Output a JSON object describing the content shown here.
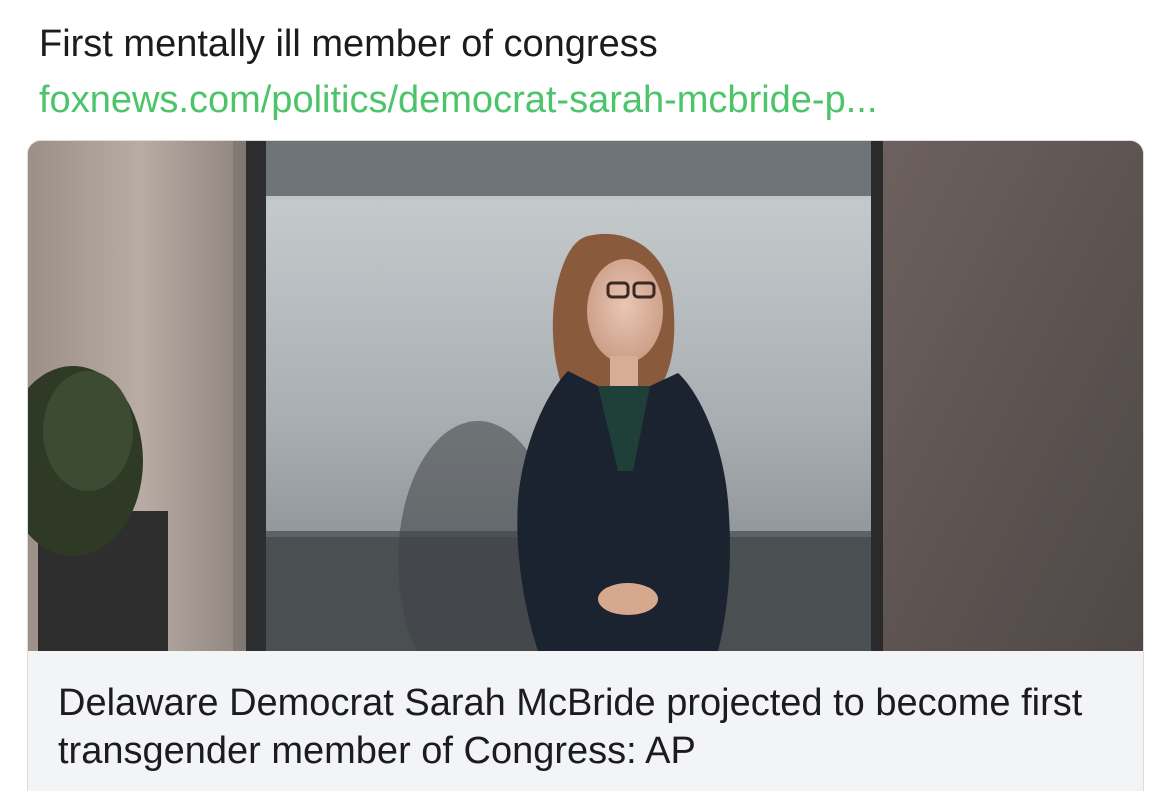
{
  "post": {
    "text": "First mentally ill member of congress",
    "link": "foxnews.com/politics/democrat-sarah-mcbride-p...",
    "link_color": "#4cc46a"
  },
  "card": {
    "image_alt": "Sarah McBride standing in front of a building wall",
    "title": "Delaware Democrat Sarah McBride projected to become first transgender member of Congress: AP"
  }
}
